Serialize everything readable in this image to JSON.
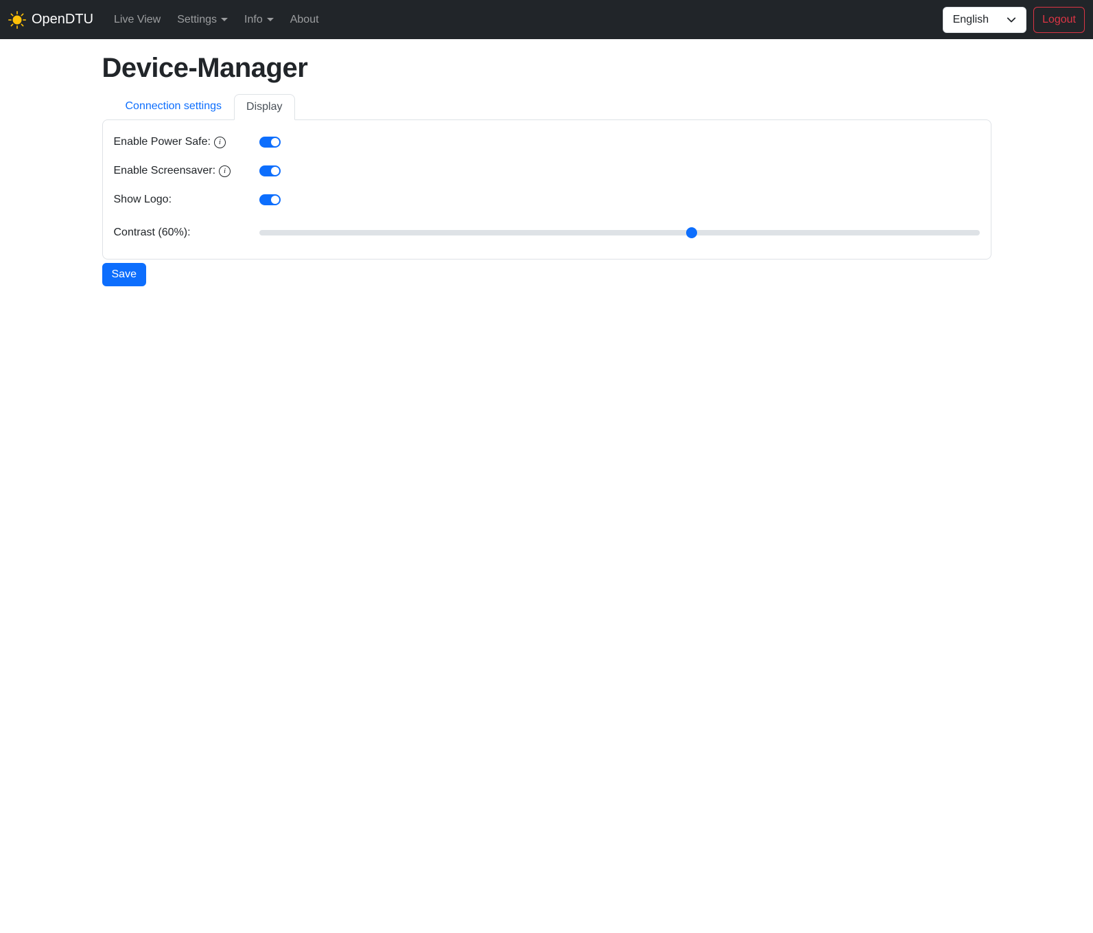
{
  "navbar": {
    "brand": "OpenDTU",
    "items": [
      {
        "label": "Live View",
        "dropdown": false
      },
      {
        "label": "Settings",
        "dropdown": true
      },
      {
        "label": "Info",
        "dropdown": true
      },
      {
        "label": "About",
        "dropdown": false
      }
    ],
    "language_selected": "English",
    "logout_label": "Logout"
  },
  "page": {
    "title": "Device-Manager"
  },
  "tabs": [
    {
      "label": "Connection settings",
      "active": false
    },
    {
      "label": "Display",
      "active": true
    }
  ],
  "form": {
    "rows": [
      {
        "label": "Enable Power Safe:",
        "has_info": true,
        "type": "toggle",
        "on": true
      },
      {
        "label": "Enable Screensaver:",
        "has_info": true,
        "type": "toggle",
        "on": true
      },
      {
        "label": "Show Logo:",
        "has_info": false,
        "type": "toggle",
        "on": true
      },
      {
        "label": "Contrast (60%):",
        "has_info": false,
        "type": "slider",
        "percent": 60
      }
    ],
    "contrast_percent": 60,
    "save_label": "Save"
  },
  "icons": {
    "info_glyph": "i"
  },
  "colors": {
    "accent": "#0d6efd",
    "navbar_bg": "#212529",
    "danger": "#dc3545",
    "brand_sun": "#ffc107",
    "border": "#dee2e6"
  }
}
